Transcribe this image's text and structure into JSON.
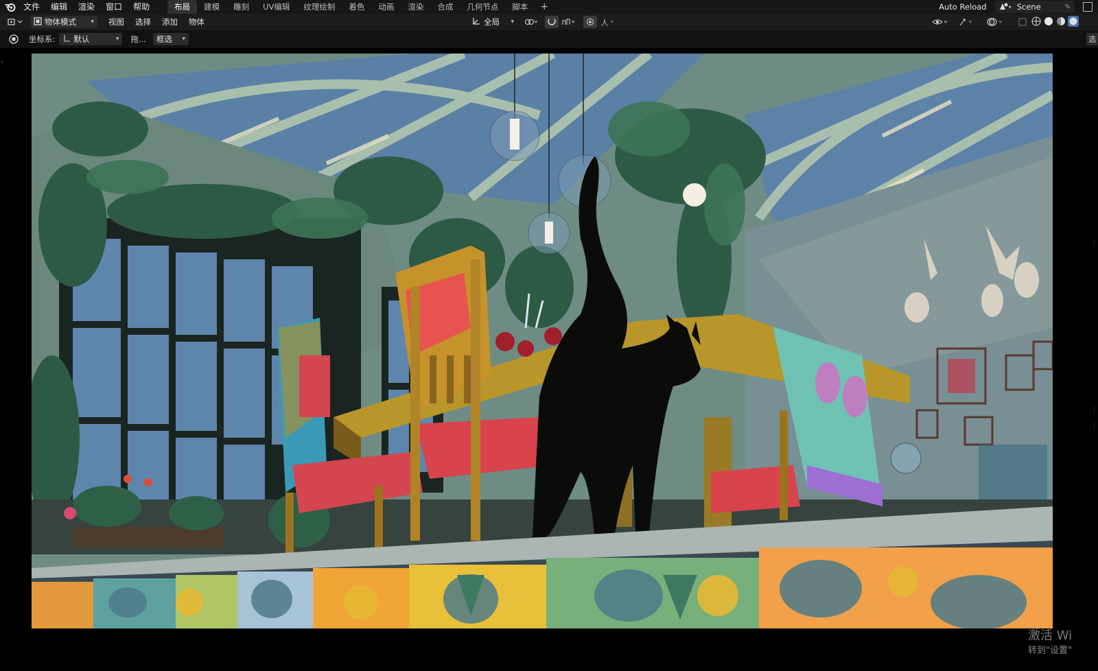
{
  "menubar": {
    "items": [
      "文件",
      "编辑",
      "渲染",
      "窗口",
      "帮助"
    ]
  },
  "workspaces": {
    "tabs": [
      "布局",
      "建模",
      "雕刻",
      "UV编辑",
      "纹理绘制",
      "着色",
      "动画",
      "渲染",
      "合成",
      "几何节点",
      "脚本"
    ],
    "active": "布局",
    "add_symbol": "+"
  },
  "topbar_right": {
    "auto_reload": "Auto Reload",
    "scene": "Scene"
  },
  "header": {
    "mode": "物体模式",
    "menus": [
      "视图",
      "选择",
      "添加",
      "物体"
    ],
    "transform_orientation": "全局"
  },
  "tool_settings": {
    "coord_label": "坐标系:",
    "coord_value": "默认",
    "drag_label": "拖...",
    "select_mode": "框选",
    "right_tab": "选"
  },
  "watermark": {
    "line1": "激活 Wi",
    "line2": "转到\"设置\""
  },
  "colors": {
    "ui_dark": "#161616",
    "tab_active": "#303030",
    "accent_blue": "#4772b3"
  }
}
